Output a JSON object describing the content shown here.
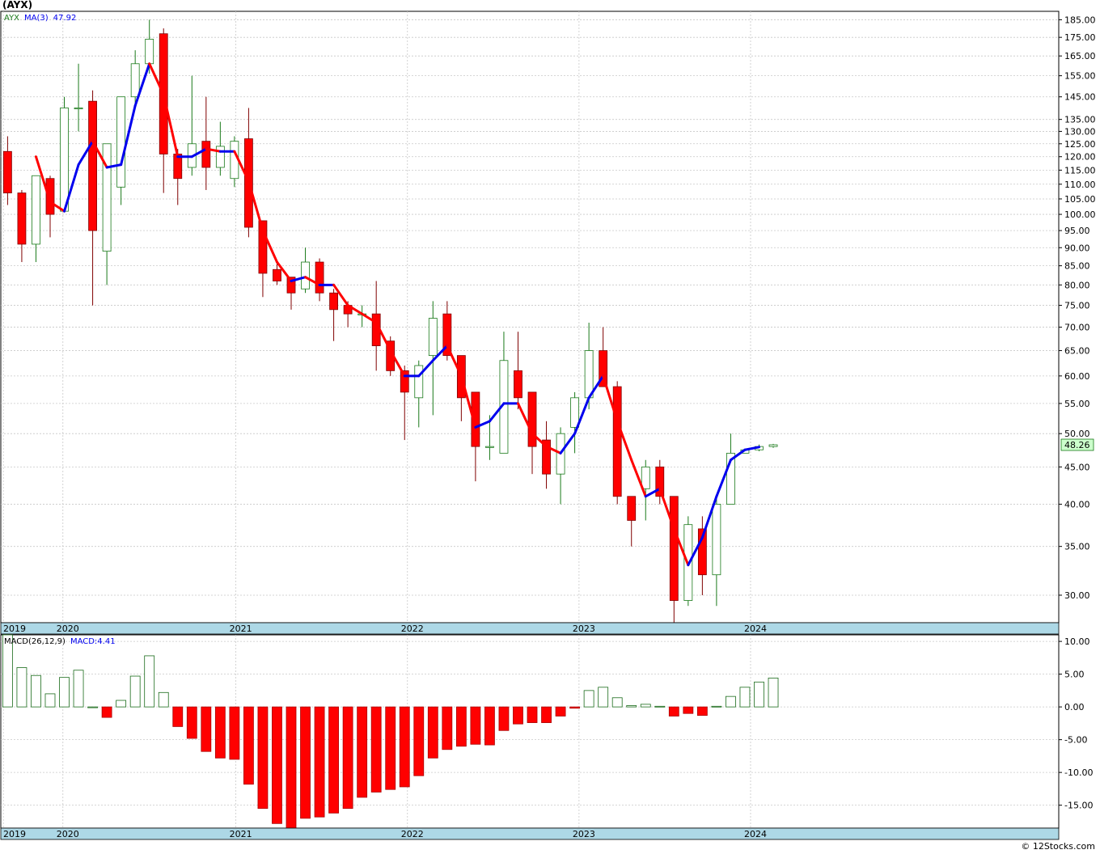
{
  "header": {
    "ticker": "(AYX)"
  },
  "watermark": "© 12Stocks.com",
  "colors": {
    "up_candle": "#1a7a1a",
    "down_candle": "#ff0000",
    "ma_up": "#0000ee",
    "ma_down": "#ff0000",
    "macd_up": "#1a6b1a",
    "macd_down": "#ff0000",
    "axis_band": "#add8e6",
    "grid": "#c8c8c8"
  },
  "chart_data": [
    {
      "type": "candlestick",
      "title": "(AYX)",
      "legend": {
        "symbol": "AYX",
        "indicator": "MA(3)",
        "indicator_value": "47.92"
      },
      "last_price_label": "48.26",
      "y_scale": "log",
      "ylim": [
        27.5,
        190
      ],
      "yticks": [
        30,
        35,
        40,
        45,
        50,
        55,
        60,
        65,
        70,
        75,
        80,
        85,
        90,
        95,
        100,
        105,
        110,
        115,
        120,
        125,
        130,
        135,
        145,
        155,
        165,
        175,
        185
      ],
      "year_labels": [
        {
          "label": "2019",
          "index": -0.3
        },
        {
          "label": "2020",
          "index": 3.9
        },
        {
          "label": "2021",
          "index": 16.1
        },
        {
          "label": "2022",
          "index": 28.2
        },
        {
          "label": "2023",
          "index": 40.3
        },
        {
          "label": "2024",
          "index": 52.4
        }
      ],
      "candles": [
        {
          "o": 122,
          "h": 128,
          "l": 103,
          "c": 107
        },
        {
          "o": 107,
          "h": 108,
          "l": 86,
          "c": 91
        },
        {
          "o": 91,
          "h": 113,
          "l": 86,
          "c": 113
        },
        {
          "o": 112,
          "h": 113,
          "l": 93,
          "c": 100
        },
        {
          "o": 101,
          "h": 145,
          "l": 101,
          "c": 140
        },
        {
          "o": 140,
          "h": 161,
          "l": 130,
          "c": 140
        },
        {
          "o": 143,
          "h": 148,
          "l": 75,
          "c": 95
        },
        {
          "o": 89,
          "h": 125,
          "l": 80,
          "c": 125
        },
        {
          "o": 109,
          "h": 145,
          "l": 103,
          "c": 145
        },
        {
          "o": 145,
          "h": 168,
          "l": 140,
          "c": 161
        },
        {
          "o": 161,
          "h": 185,
          "l": 156,
          "c": 174
        },
        {
          "o": 177,
          "h": 180,
          "l": 107,
          "c": 121
        },
        {
          "o": 121,
          "h": 123,
          "l": 103,
          "c": 112
        },
        {
          "o": 116,
          "h": 155,
          "l": 113,
          "c": 125
        },
        {
          "o": 126,
          "h": 145,
          "l": 108,
          "c": 116
        },
        {
          "o": 116,
          "h": 134,
          "l": 113,
          "c": 124
        },
        {
          "o": 112,
          "h": 128,
          "l": 109,
          "c": 126
        },
        {
          "o": 127,
          "h": 140,
          "l": 93,
          "c": 96
        },
        {
          "o": 98,
          "h": 98,
          "l": 77,
          "c": 83
        },
        {
          "o": 84,
          "h": 86,
          "l": 80,
          "c": 81
        },
        {
          "o": 82,
          "h": 82,
          "l": 74,
          "c": 78
        },
        {
          "o": 79,
          "h": 90,
          "l": 78,
          "c": 86
        },
        {
          "o": 86,
          "h": 87,
          "l": 76,
          "c": 78
        },
        {
          "o": 78,
          "h": 79,
          "l": 67,
          "c": 74
        },
        {
          "o": 75,
          "h": 76,
          "l": 70,
          "c": 73
        },
        {
          "o": 73,
          "h": 75,
          "l": 70,
          "c": 73
        },
        {
          "o": 73,
          "h": 81,
          "l": 61,
          "c": 66
        },
        {
          "o": 67,
          "h": 68,
          "l": 60,
          "c": 61
        },
        {
          "o": 61,
          "h": 62,
          "l": 49,
          "c": 57
        },
        {
          "o": 56,
          "h": 63,
          "l": 51,
          "c": 62
        },
        {
          "o": 64,
          "h": 76,
          "l": 53,
          "c": 72
        },
        {
          "o": 73,
          "h": 76,
          "l": 63,
          "c": 64
        },
        {
          "o": 64,
          "h": 64,
          "l": 52,
          "c": 56
        },
        {
          "o": 57,
          "h": 57,
          "l": 43,
          "c": 48
        },
        {
          "o": 48,
          "h": 53,
          "l": 46,
          "c": 48
        },
        {
          "o": 47,
          "h": 69,
          "l": 47,
          "c": 63
        },
        {
          "o": 61,
          "h": 69,
          "l": 54,
          "c": 56
        },
        {
          "o": 57,
          "h": 57,
          "l": 44,
          "c": 48
        },
        {
          "o": 49,
          "h": 52,
          "l": 42,
          "c": 44
        },
        {
          "o": 44,
          "h": 51,
          "l": 40,
          "c": 50
        },
        {
          "o": 51,
          "h": 57,
          "l": 47,
          "c": 56
        },
        {
          "o": 56,
          "h": 71,
          "l": 54,
          "c": 65
        },
        {
          "o": 65,
          "h": 70,
          "l": 58,
          "c": 58
        },
        {
          "o": 58,
          "h": 59,
          "l": 40,
          "c": 41
        },
        {
          "o": 41,
          "h": 41,
          "l": 35,
          "c": 38
        },
        {
          "o": 42,
          "h": 46,
          "l": 38,
          "c": 45
        },
        {
          "o": 45,
          "h": 46,
          "l": 40,
          "c": 41
        },
        {
          "o": 41,
          "h": 41,
          "l": 27.5,
          "c": 29.5
        },
        {
          "o": 29.5,
          "h": 38.5,
          "l": 29,
          "c": 37.5
        },
        {
          "o": 37,
          "h": 38.5,
          "l": 30,
          "c": 32
        },
        {
          "o": 32,
          "h": 41,
          "l": 29,
          "c": 40
        },
        {
          "o": 40,
          "h": 50,
          "l": 40,
          "c": 47
        },
        {
          "o": 47,
          "h": 47.5,
          "l": 47,
          "c": 47.5
        },
        {
          "o": 47.5,
          "h": 48.3,
          "l": 47.3,
          "c": 48
        },
        {
          "o": 48,
          "h": 48.4,
          "l": 47.8,
          "c": 48.26
        }
      ],
      "ma3": [
        120,
        104,
        101,
        117,
        126,
        116,
        117,
        141,
        161,
        146,
        120,
        120,
        123,
        122,
        122,
        111,
        95,
        86,
        81,
        82,
        80,
        80,
        75,
        73,
        71,
        65,
        60,
        60,
        63,
        66,
        60,
        51,
        52,
        55,
        55,
        50,
        48,
        47,
        50,
        56,
        60,
        52,
        46,
        41,
        42,
        37,
        33,
        36,
        41,
        46,
        47.5,
        47.92
      ]
    },
    {
      "type": "bar",
      "title": "MACD(26,12,9)",
      "legend": {
        "indicator": "MACD(26,12,9)",
        "indicator_label": "MACD:4.41"
      },
      "ylim": [
        -18.5,
        11
      ],
      "yticks": [
        10,
        5,
        0,
        -5,
        -10,
        -15
      ],
      "ytick_labels": [
        "10.00",
        "5.00",
        "0.00",
        "-5.00",
        "-10.00",
        "-15.00"
      ],
      "year_labels": [
        {
          "label": "2019",
          "index": -0.3
        },
        {
          "label": "2020",
          "index": 3.9
        },
        {
          "label": "2021",
          "index": 16.1
        },
        {
          "label": "2022",
          "index": 28.2
        },
        {
          "label": "2023",
          "index": 40.3
        },
        {
          "label": "2024",
          "index": 52.4
        }
      ],
      "values": [
        11,
        6,
        4.8,
        2,
        4.5,
        5.6,
        0,
        -1.6,
        1,
        4.7,
        7.8,
        2.2,
        -3,
        -4.8,
        -6.8,
        -7.8,
        -8,
        -11.8,
        -15.5,
        -17.8,
        -18.5,
        -17,
        -16.8,
        -16.2,
        -15.5,
        -13.8,
        -13,
        -12.6,
        -12.2,
        -10.5,
        -7.8,
        -6.5,
        -6,
        -5.7,
        -5.8,
        -3.6,
        -2.6,
        -2.4,
        -2.4,
        -1.4,
        -0.2,
        2.5,
        3,
        1.4,
        0.2,
        0.4,
        0.1,
        -1.4,
        -1,
        -1.3,
        0.1,
        1.6,
        3,
        3.8,
        4.41
      ]
    }
  ]
}
